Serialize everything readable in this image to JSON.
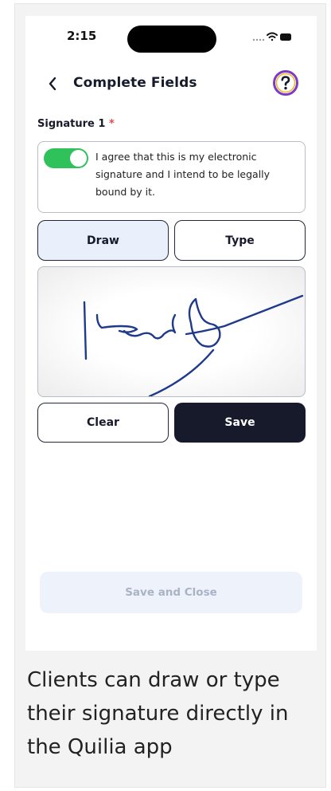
{
  "status_bar": {
    "time": "2:15"
  },
  "header": {
    "title": "Complete Fields",
    "help_icon": "question-circle-icon",
    "back_icon": "chevron-left-icon"
  },
  "field": {
    "label": "Signature 1",
    "required_mark": "*",
    "consent_text": "I agree that this is my electronic signature and I intend to be legally bound by it.",
    "consent_enabled": true
  },
  "mode_tabs": {
    "draw_label": "Draw",
    "type_label": "Type",
    "selected": "Draw"
  },
  "actions": {
    "clear_label": "Clear",
    "save_label": "Save",
    "save_close_label": "Save and Close"
  },
  "caption": "Clients can draw or type their signature directly in the Quilia app",
  "colors": {
    "accent_dark": "#171a2b",
    "toggle_on": "#2fc25b",
    "required": "#e4484b",
    "ink": "#1f3a8a",
    "help_ring": "#7a3cc7"
  }
}
